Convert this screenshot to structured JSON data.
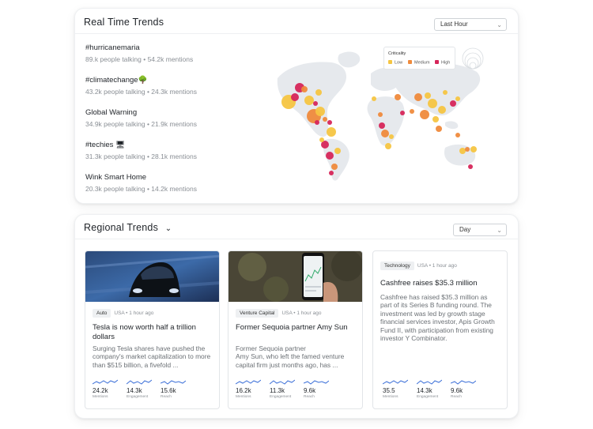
{
  "realtime": {
    "title": "Real Time Trends",
    "period_select": "Last Hour",
    "trends": [
      {
        "name": "#hurricanemaria",
        "stats": "89.k people talking • 54.2k mentions"
      },
      {
        "name": "#climatechange🌳",
        "stats": "43.2k people talking • 24.3k mentions"
      },
      {
        "name": "Global Warning",
        "stats": "34.9k people talking • 21.9k mentions"
      },
      {
        "name": "#techies 🖥",
        "stats": "31.3k people talking • 28.1k mentions"
      },
      {
        "name": "Wink Smart Home",
        "stats": "20.3k people talking • 14.2k mentions"
      }
    ],
    "legend": {
      "title": "Criticality",
      "items": [
        {
          "label": "Low",
          "color": "#f5c542"
        },
        {
          "label": "Medium",
          "color": "#ef8a3c"
        },
        {
          "label": "High",
          "color": "#d6265a"
        }
      ]
    }
  },
  "regional": {
    "title": "Regional Trends",
    "period_select": "Day",
    "cards": [
      {
        "tag": "Auto",
        "meta": "USA • 1 hour ago",
        "title": "Tesla is now worth half a trillion dollars",
        "body": "Surging Tesla shares have pushed the company's market capitalization to more than $515 billion, a fivefold ...",
        "metrics": [
          {
            "value": "24.2k",
            "label": "Mentions"
          },
          {
            "value": "14.3k",
            "label": "Engagement"
          },
          {
            "value": "15.6k",
            "label": "Reach"
          }
        ]
      },
      {
        "tag": "Venture Capital",
        "meta": "USA • 1 hour ago",
        "title": "Former Sequoia partner Amy Sun",
        "body": "Former Sequoia partner\nAmy Sun, who left the famed venture capital firm just months ago, has ...",
        "metrics": [
          {
            "value": "16.2k",
            "label": "Mentions"
          },
          {
            "value": "11.3k",
            "label": "Engagement"
          },
          {
            "value": "9.6k",
            "label": "Reach"
          }
        ]
      },
      {
        "tag": "Technology",
        "meta": "USA • 1 hour ago",
        "title": "Cashfree raises $35.3 million",
        "body": "Cashfree has raised $35.3 million as part of its Series B funding round. The investment was led by growth stage financial services investor, Apis Growth Fund II, with participation from existing investor Y Combinator.",
        "metrics": [
          {
            "value": "35.5",
            "label": "Mentions"
          },
          {
            "value": "14.3k",
            "label": "Engagement"
          },
          {
            "value": "9.6k",
            "label": "Reach"
          }
        ]
      }
    ]
  },
  "colors": {
    "sparkline": "#3b6fd8",
    "map_land": "#e6e9ed"
  }
}
